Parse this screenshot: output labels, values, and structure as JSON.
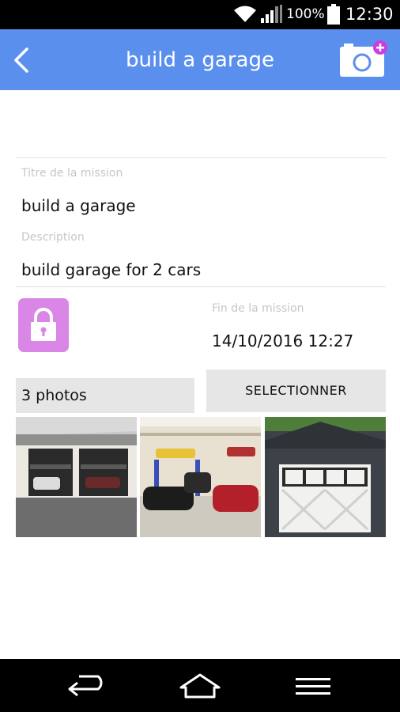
{
  "status_bar": {
    "battery_percent": "100%",
    "time": "12:30",
    "icons": [
      "wifi-icon",
      "signal-icon",
      "battery-icon"
    ]
  },
  "app_bar": {
    "title": "build a garage",
    "back_icon": "chevron-left-icon",
    "add_photo_icon": "camera-add-icon"
  },
  "form": {
    "title_label": "Titre de la mission",
    "title_value": "build a garage",
    "description_label": "Description",
    "description_value": "build garage for 2 cars",
    "lock_icon": "lock-icon",
    "end_label": "Fin de la mission",
    "end_value": "14/10/2016 12:27"
  },
  "photos": {
    "count_label": "3 photos",
    "select_label": "SELECTIONNER",
    "items": [
      "garage-photo-1",
      "garage-photo-2",
      "garage-photo-3"
    ]
  },
  "colors": {
    "app_bar": "#5b8fee",
    "lock_tile": "#d986e6",
    "badge": "#c93ee0",
    "button_bg": "#e6e6e6"
  },
  "nav_bar": {
    "icons": [
      "back-arrow-icon",
      "home-icon",
      "menu-icon"
    ]
  }
}
